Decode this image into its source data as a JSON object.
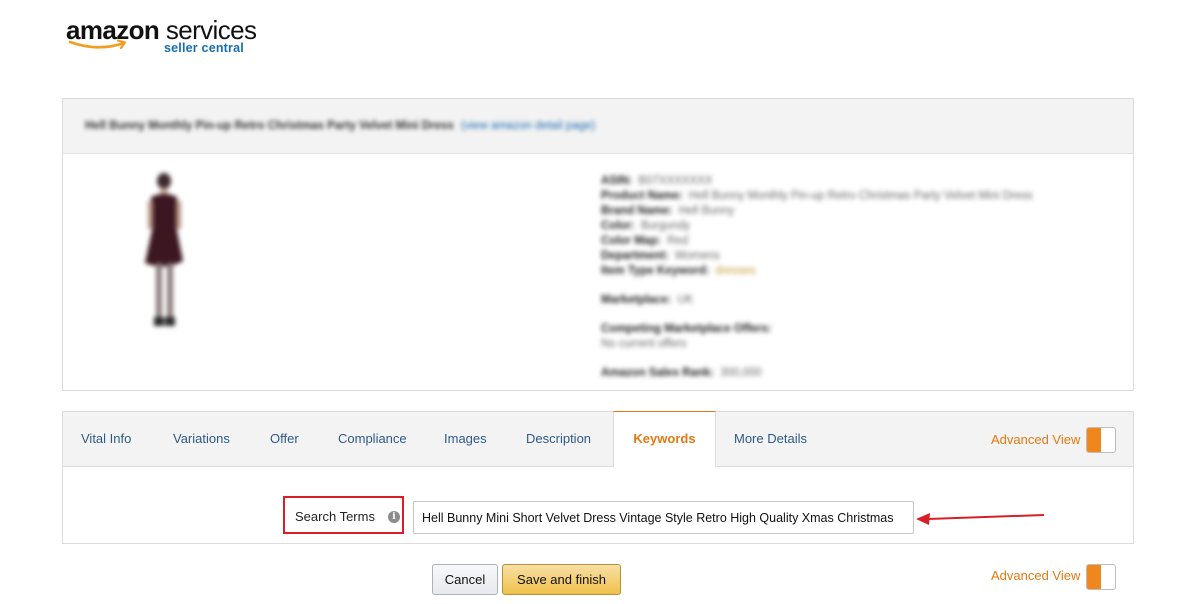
{
  "logo": {
    "brand": "amazon",
    "product": " services",
    "subtitle": "seller central"
  },
  "product": {
    "title": "Hell Bunny Monthly Pin-up Retro Christmas Party Velvet Mini Dress",
    "detail_link": "(view amazon detail page)",
    "details": [
      {
        "label": "ASIN:",
        "value": "B07XXXXXXX"
      },
      {
        "label": "Product Name:",
        "value": "Hell Bunny Monthly Pin-up Retro Christmas Party Velvet Mini Dress"
      },
      {
        "label": "Brand Name:",
        "value": "Hell Bunny"
      },
      {
        "label": "Color:",
        "value": "Burgundy"
      },
      {
        "label": "Color Map:",
        "value": "Red"
      },
      {
        "label": "Department:",
        "value": "Womens"
      },
      {
        "label": "Item Type Keyword:",
        "value": "dresses",
        "accent": true
      }
    ],
    "marketplace_label": "Marketplace:",
    "marketplace_value": "UK",
    "competing_label": "Competing Marketplace Offers:",
    "competing_value": "No current offers",
    "sales_rank_label": "Amazon Sales Rank:",
    "sales_rank_value": "300,000"
  },
  "tabs": [
    {
      "label": "Vital Info"
    },
    {
      "label": "Variations"
    },
    {
      "label": "Offer"
    },
    {
      "label": "Compliance"
    },
    {
      "label": "Images"
    },
    {
      "label": "Description"
    },
    {
      "label": "Keywords",
      "active": true
    },
    {
      "label": "More Details"
    }
  ],
  "advanced_view_label": "Advanced View",
  "advanced_view_on": true,
  "search_terms": {
    "label": "Search Terms",
    "info_glyph": "i",
    "value": "Hell Bunny Mini Short Velvet Dress Vintage Style Retro High Quality Xmas Christmas"
  },
  "buttons": {
    "cancel": "Cancel",
    "save": "Save and finish"
  },
  "colors": {
    "accent": "#e47911",
    "toggle_on": "#f0861e",
    "highlight": "#d61f26",
    "link": "#2f5a87",
    "save_button": "#f0c14b"
  }
}
